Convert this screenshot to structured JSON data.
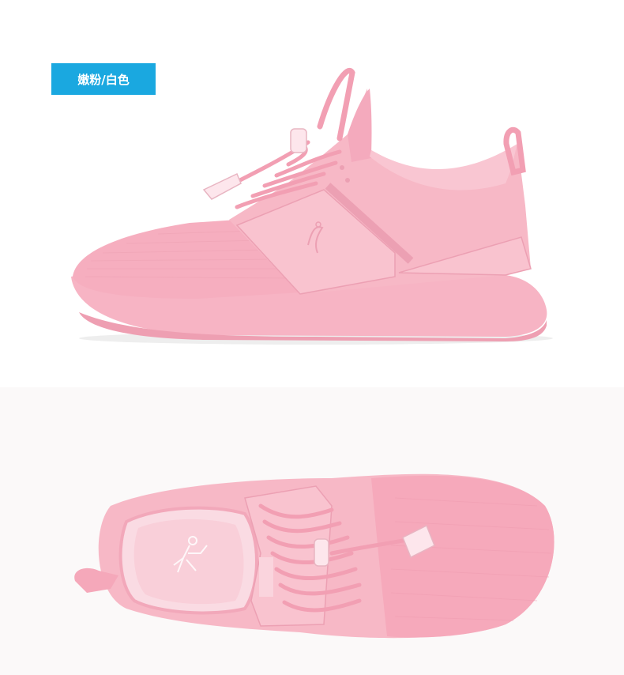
{
  "color_badge": {
    "label": "嫩粉/白色",
    "background": "#1aa8e0",
    "text_color": "#ffffff"
  },
  "colors": {
    "shoe_pink": "#f7b8c6",
    "shoe_pink_dark": "#ee9fb2",
    "sole": "#f9c3cf",
    "toggle": "#fde6ec"
  },
  "images": [
    {
      "name": "side-view",
      "description_icon": "pink-sneaker-side"
    },
    {
      "name": "top-view",
      "description_icon": "pink-sneaker-top"
    }
  ]
}
